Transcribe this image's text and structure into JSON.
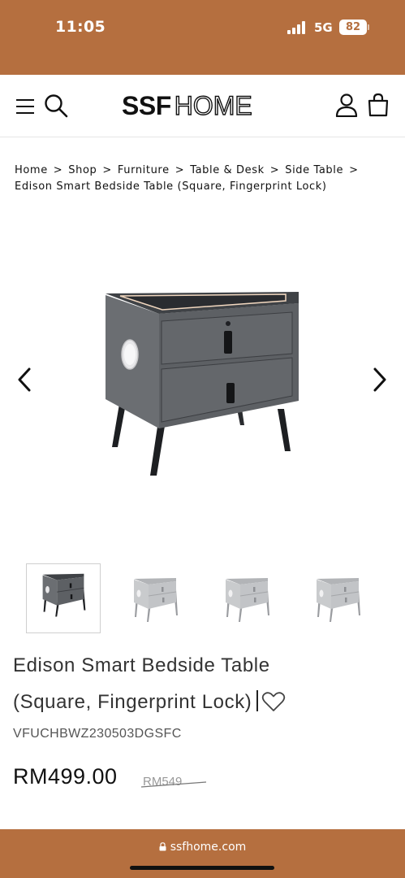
{
  "status_bar": {
    "time": "11:05",
    "network": "5G",
    "battery": "82",
    "background_color": "#b56f3f"
  },
  "header": {
    "logo_bold": "SSF",
    "logo_outline": "HOME",
    "icons": [
      "hamburger-menu-icon",
      "search-icon",
      "user-icon",
      "shopping-bag-icon"
    ]
  },
  "breadcrumb": {
    "items": [
      "Home",
      "Shop",
      "Furniture",
      "Table & Desk",
      "Side Table",
      "Edison Smart Bedside Table (Square, Fingerprint Lock)"
    ],
    "separator": ">"
  },
  "gallery": {
    "prev_icon": "chevron-left-icon",
    "next_icon": "chevron-right-icon",
    "thumbnail_count": 4,
    "active_thumbnail": 1
  },
  "product": {
    "title_line1": "Edison Smart Bedside Table",
    "title_line2": "(Square, Fingerprint Lock)",
    "sku": "VFUCHBWZ230503DGSFC",
    "price": "RM499.00",
    "old_price": "RM549",
    "wishlist_icon": "heart-icon"
  },
  "browser": {
    "url": "ssfhome.com",
    "bar_color": "#b56f3f"
  }
}
